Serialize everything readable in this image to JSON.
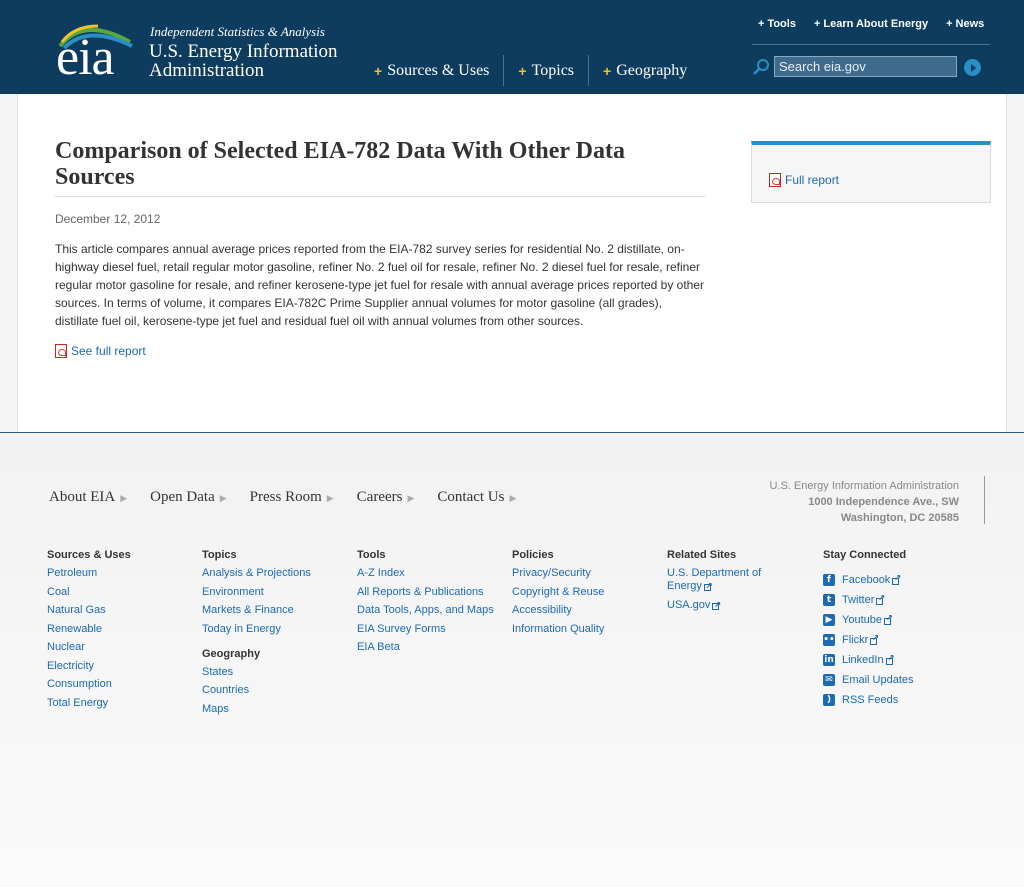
{
  "header": {
    "logo_text": "eia",
    "tagline": "Independent Statistics & Analysis",
    "org_name": "U.S. Energy Information Administration",
    "main_nav": [
      {
        "label": "Sources & Uses"
      },
      {
        "label": "Topics"
      },
      {
        "label": "Geography"
      }
    ],
    "util_nav": [
      {
        "label": "Tools"
      },
      {
        "label": "Learn About Energy"
      },
      {
        "label": "News"
      }
    ],
    "search": {
      "placeholder": "Search eia.gov"
    }
  },
  "article": {
    "title": "Comparison of Selected EIA-782 Data With Other Data Sources",
    "date": "December 12, 2012",
    "description": "This article compares annual average prices reported from the EIA-782 survey series for residential No. 2 distillate, on-highway diesel fuel, retail regular motor gasoline, refiner No. 2 fuel oil for resale, refiner No. 2 diesel fuel for resale, refiner regular motor gasoline for resale, and refiner kerosene-type jet fuel for resale with annual average prices reported by other sources. In terms of volume, it compares EIA-782C Prime Supplier annual volumes for motor gasoline (all grades), distillate fuel oil, kerosene-type jet fuel and residual fuel oil with annual volumes from other sources.",
    "see_report_label": "See full report"
  },
  "sidebar": {
    "full_report_label": "Full report"
  },
  "footer": {
    "nav": [
      {
        "label": "About EIA"
      },
      {
        "label": "Open Data"
      },
      {
        "label": "Press Room"
      },
      {
        "label": "Careers"
      },
      {
        "label": "Contact Us"
      }
    ],
    "address": {
      "line1": "U.S. Energy Information Administration",
      "line2": "1000 Independence Ave., SW",
      "line3": "Washington, DC 20585"
    },
    "columns": {
      "sources": {
        "heading": "Sources & Uses",
        "links": [
          "Petroleum",
          "Coal",
          "Natural Gas",
          "Renewable",
          "Nuclear",
          "Electricity",
          "Consumption",
          "Total Energy"
        ]
      },
      "topics": {
        "heading": "Topics",
        "links": [
          "Analysis & Projections",
          "Environment",
          "Markets & Finance",
          "Today in Energy"
        ]
      },
      "geography": {
        "heading": "Geography",
        "links": [
          "States",
          "Countries",
          "Maps"
        ]
      },
      "tools": {
        "heading": "Tools",
        "links": [
          "A-Z Index",
          "All Reports & Publications",
          "Data Tools, Apps, and Maps",
          "EIA Survey Forms",
          "EIA Beta"
        ]
      },
      "policies": {
        "heading": "Policies",
        "links": [
          "Privacy/Security",
          "Copyright & Reuse",
          "Accessibility",
          "Information Quality"
        ]
      },
      "related": {
        "heading": "Related Sites",
        "links": [
          "U.S. Department of Energy",
          "USA.gov"
        ]
      },
      "stay": {
        "heading": "Stay Connected",
        "links": [
          {
            "label": "Facebook",
            "icon": "facebook-icon"
          },
          {
            "label": "Twitter",
            "icon": "twitter-icon"
          },
          {
            "label": "Youtube",
            "icon": "youtube-icon"
          },
          {
            "label": "Flickr",
            "icon": "flickr-icon"
          },
          {
            "label": "LinkedIn",
            "icon": "linkedin-icon"
          },
          {
            "label": "Email Updates",
            "icon": "email-icon"
          },
          {
            "label": "RSS Feeds",
            "icon": "rss-icon"
          }
        ]
      }
    }
  },
  "colors": {
    "header_bg": "#0d3c5e",
    "link": "#1b6ab3",
    "accent": "#2a8fc4",
    "nav_plus": "#f2c12e"
  }
}
